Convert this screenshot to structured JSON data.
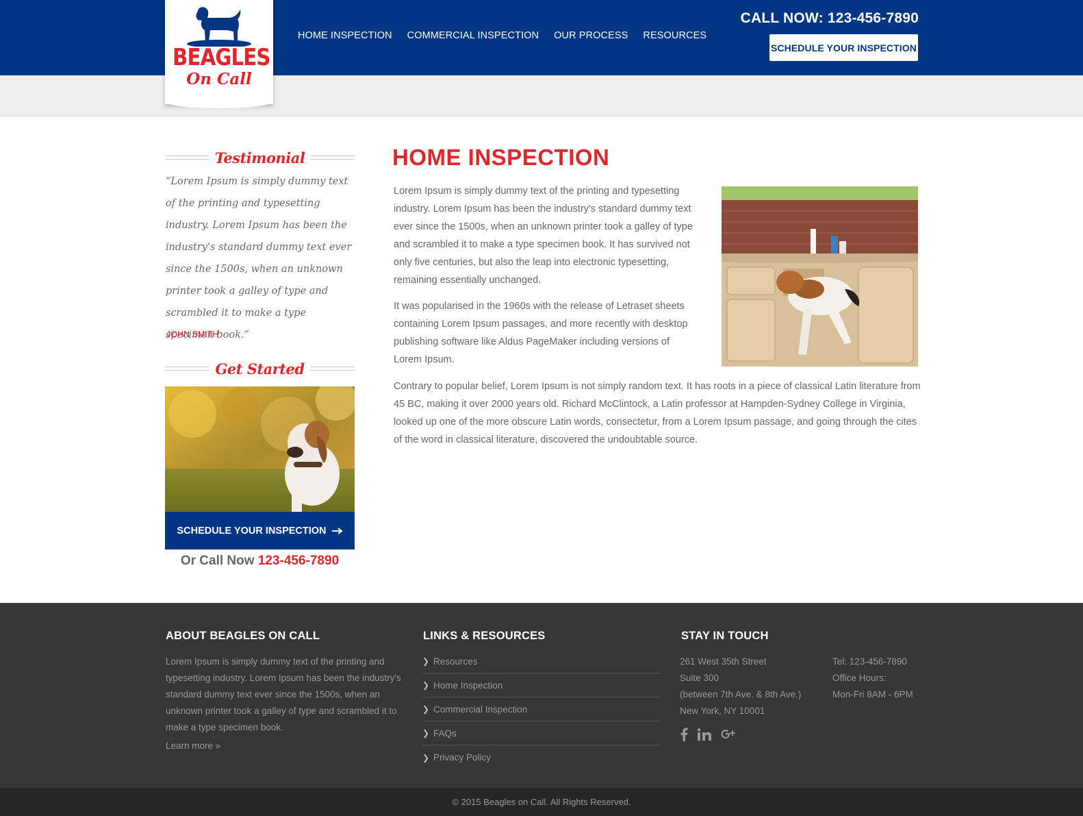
{
  "header": {
    "logo_word": "BEAGLES",
    "logo_sub": "On Call",
    "nav": [
      "HOME INSPECTION",
      "COMMERCIAL INSPECTION",
      "OUR PROCESS",
      "RESOURCES"
    ],
    "call_now": "CALL NOW: 123-456-7890",
    "schedule_label": "SCHEDULE YOUR INSPECTION"
  },
  "sidebar": {
    "testimonial_heading": "Testimonial",
    "quote": "“Lorem Ipsum is simply dummy text of the printing and typesetting industry. Lorem Ipsum has been the industry's standard dummy text ever since the 1500s, when an unknown printer took a galley of type and scrambled it to make a type specimen book.”",
    "author": "JOHN SMITH",
    "get_started_heading": "Get Started",
    "schedule_label": "SCHEDULE YOUR INSPECTION",
    "or_call": "Or Call Now",
    "phone": "123-456-7890"
  },
  "main": {
    "title": "HOME INSPECTION",
    "p1": "Lorem Ipsum is simply dummy text of the printing and typesetting industry. Lorem Ipsum has been the industry's standard dummy text ever since the 1500s, when an unknown printer took a galley of type and scrambled it to make a type specimen book. It has survived not only five centuries, but also the leap into electronic typesetting, remaining essentially unchanged.",
    "p2": "It was popularised in the 1960s with the release of Letraset sheets containing Lorem Ipsum passages, and more recently with desktop publishing software like Aldus PageMaker including versions of Lorem Ipsum.",
    "p3": "Contrary to popular belief, Lorem Ipsum is not simply random text. It has roots in a piece of classical Latin literature from 45 BC, making it over 2000 years old. Richard McClintock, a Latin professor at Hampden-Sydney College in Virginia, looked up one of the more obscure Latin words, consectetur, from a Lorem Ipsum passage, and going through the cites of the word in classical literature, discovered the undoubtable source."
  },
  "footer": {
    "about_heading": "ABOUT BEAGLES ON CALL",
    "about_text": "Lorem Ipsum is simply dummy text of the printing and typesetting industry. Lorem Ipsum has been the industry's standard dummy text ever since the 1500s, when an unknown printer took a galley of type and scrambled it to make a type specimen book.",
    "learn_more": "Learn more »",
    "links_heading": "LINKS & RESOURCES",
    "links": [
      "Resources",
      "Home Inspection",
      "Commercial Inspection",
      "FAQs",
      "Privacy Policy"
    ],
    "touch_heading": "STAY IN TOUCH",
    "address": [
      "261 West 35th Street",
      "Suite 300",
      "(between 7th Ave. & 8th Ave.)",
      "New York, NY 10001"
    ],
    "contact": [
      "Tel: 123-456-7890",
      "Office Hours:",
      "Mon-Fri 8AM - 6PM"
    ],
    "social_icons": [
      "facebook-icon",
      "linkedin-icon",
      "google-plus-icon"
    ],
    "copyright": "© 2015 Beagles on Call. All Rights Reserved."
  },
  "colors": {
    "brand_blue": "#003684",
    "accent_red": "#e0262b",
    "footer_bg": "#363636"
  }
}
